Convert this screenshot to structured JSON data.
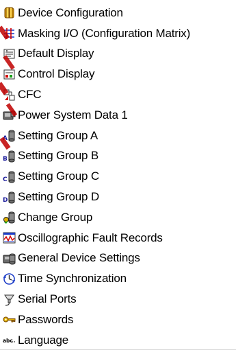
{
  "tree": {
    "items": [
      {
        "label": "Device Configuration",
        "icon": "device-configuration-icon"
      },
      {
        "label": "Masking I/O (Configuration Matrix)",
        "icon": "masking-matrix-icon"
      },
      {
        "label": "Default Display",
        "icon": "default-display-icon"
      },
      {
        "label": "Control Display",
        "icon": "control-display-icon"
      },
      {
        "label": "CFC",
        "icon": "cfc-icon"
      },
      {
        "label": "Power System Data 1",
        "icon": "power-system-data-icon"
      },
      {
        "label": "Setting Group A",
        "icon": "setting-group-a-icon"
      },
      {
        "label": "Setting Group B",
        "icon": "setting-group-b-icon"
      },
      {
        "label": "Setting Group C",
        "icon": "setting-group-c-icon"
      },
      {
        "label": "Setting Group D",
        "icon": "setting-group-d-icon"
      },
      {
        "label": "Change Group",
        "icon": "change-group-icon"
      },
      {
        "label": "Oscillographic Fault Records",
        "icon": "oscillographic-records-icon"
      },
      {
        "label": "General Device Settings",
        "icon": "general-device-settings-icon"
      },
      {
        "label": "Time Synchronization",
        "icon": "time-synchronization-icon"
      },
      {
        "label": "Serial Ports",
        "icon": "serial-ports-icon"
      },
      {
        "label": "Passwords",
        "icon": "passwords-icon"
      },
      {
        "label": "Language",
        "icon": "language-icon"
      }
    ]
  },
  "colors": {
    "background": "#ffffff",
    "text": "#000000",
    "watermark": "#c00000"
  }
}
